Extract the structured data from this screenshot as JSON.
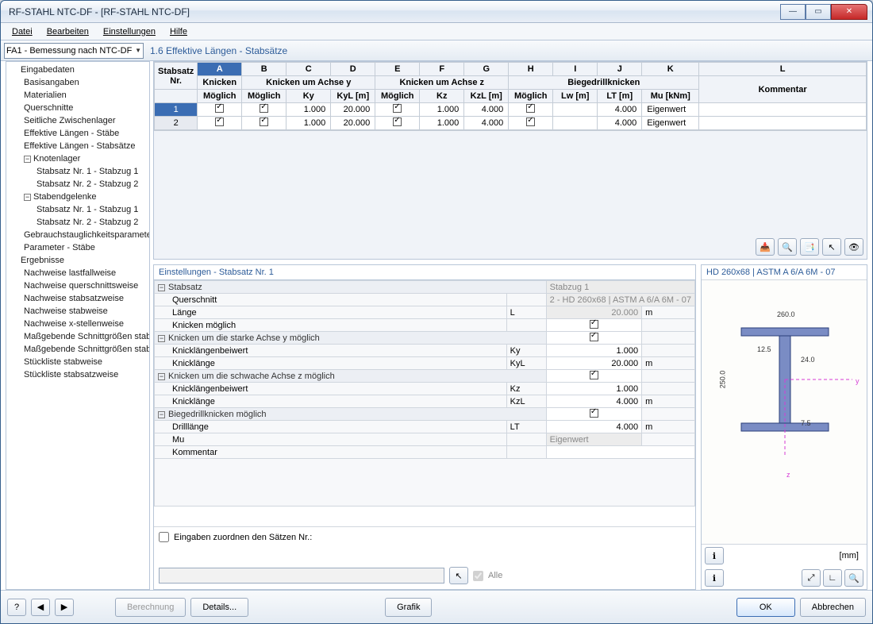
{
  "title": "RF-STAHL NTC-DF - [RF-STAHL NTC-DF]",
  "menus": {
    "file": "Datei",
    "edit": "Bearbeiten",
    "settings": "Einstellungen",
    "help": "Hilfe"
  },
  "load_combo": "FA1 - Bemessung nach NTC-DF",
  "section_heading": "1.6 Effektive Längen - Stabsätze",
  "tree": {
    "eingabedaten": "Eingabedaten",
    "basisangaben": "Basisangaben",
    "materialien": "Materialien",
    "querschnitte": "Querschnitte",
    "seitliche": "Seitliche Zwischenlager",
    "eff_staebe": "Effektive Längen - Stäbe",
    "eff_stabsaetze": "Effektive Längen - Stabsätze",
    "knotenlager": "Knotenlager",
    "knotenlager1": "Stabsatz Nr. 1 - Stabzug 1",
    "knotenlager2": "Stabsatz Nr. 2 - Stabzug 2",
    "stabendgelenke": "Stabendgelenke",
    "stabend1": "Stabsatz Nr. 1 - Stabzug 1",
    "stabend2": "Stabsatz Nr. 2 - Stabzug 2",
    "gebrauchs": "Gebrauchstauglichkeitsparameter",
    "param_staebe": "Parameter - Stäbe",
    "ergebnisse": "Ergebnisse",
    "nw_lastfall": "Nachweise lastfallweise",
    "nw_querschnitt": "Nachweise querschnittsweise",
    "nw_stabsatz": "Nachweise stabsatzweise",
    "nw_stab": "Nachweise stabweise",
    "nw_xstellen": "Nachweise x-stellenweise",
    "mass_stab": "Maßgebende Schnittgrößen stabweise",
    "mass_stabsatz": "Maßgebende Schnittgrößen stabsatzweise",
    "stueck_stab": "Stückliste stabweise",
    "stueck_stabsatz": "Stückliste stabsatzweise"
  },
  "grid": {
    "col_letters": [
      "A",
      "B",
      "C",
      "D",
      "E",
      "F",
      "G",
      "H",
      "I",
      "J",
      "K",
      "L"
    ],
    "h_stabsatz": "Stabsatz",
    "h_nr": "Nr.",
    "h_knicken": "Knicken",
    "h_moeglich": "Möglich",
    "h_knicken_y": "Knicken um Achse y",
    "h_ky": "Ky",
    "h_kyl": "KyL [m]",
    "h_knicken_z": "Knicken um Achse z",
    "h_kz": "Kz",
    "h_kzl": "KzL [m]",
    "h_biege": "Biegedrillknicken",
    "h_lw": "Lw [m]",
    "h_lt": "LT [m]",
    "h_mu": "Mu [kNm]",
    "h_kommentar": "Kommentar",
    "rows": [
      {
        "nr": "1",
        "ky": "1.000",
        "kyl": "20.000",
        "kz": "1.000",
        "kzl": "4.000",
        "lw": "",
        "lt": "4.000",
        "mu": "Eigenwert"
      },
      {
        "nr": "2",
        "ky": "1.000",
        "kyl": "20.000",
        "kz": "1.000",
        "kzl": "4.000",
        "lw": "",
        "lt": "4.000",
        "mu": "Eigenwert"
      }
    ]
  },
  "settings": {
    "title": "Einstellungen - Stabsatz Nr. 1",
    "stabsatz_lbl": "Stabsatz",
    "stabsatz_val": "Stabzug 1",
    "querschnitt_lbl": "Querschnitt",
    "querschnitt_val": "2 - HD 260x68 | ASTM A 6/A 6M - 07",
    "laenge_lbl": "Länge",
    "laenge_sym": "L",
    "laenge_val": "20.000",
    "laenge_unit": "m",
    "knick_moeg": "Knicken möglich",
    "knick_y_hdr": "Knicken um die starke Achse y möglich",
    "knickbeiwert": "Knicklängenbeiwert",
    "ky_sym": "Ky",
    "ky_val": "1.000",
    "knicklaenge": "Knicklänge",
    "kyl_sym": "KyL",
    "kyl_val": "20.000",
    "kyl_unit": "m",
    "knick_z_hdr": "Knicken um die schwache Achse z möglich",
    "kz_sym": "Kz",
    "kz_val": "1.000",
    "kzl_sym": "KzL",
    "kzl_val": "4.000",
    "kzl_unit": "m",
    "biege_hdr": "Biegedrillknicken möglich",
    "drilllaenge": "Drilllänge",
    "lt_sym": "LT",
    "lt_val": "4.000",
    "lt_unit": "m",
    "mu_lbl": "Mu",
    "mu_val": "Eigenwert",
    "kommentar_lbl": "Kommentar",
    "assign_label": "Eingaben zuordnen den Sätzen Nr.:",
    "alle": "Alle"
  },
  "preview": {
    "title": "HD 260x68 | ASTM A 6/A 6M - 07",
    "dim_width": "260.0",
    "dim_height": "250.0",
    "dim_tf": "12.5",
    "dim_tw": "24.0",
    "dim_r": "7.5",
    "unit": "[mm]",
    "axis_y": "y",
    "axis_z": "z"
  },
  "buttons": {
    "berechnung": "Berechnung",
    "details": "Details...",
    "grafik": "Grafik",
    "ok": "OK",
    "abbrechen": "Abbrechen"
  }
}
